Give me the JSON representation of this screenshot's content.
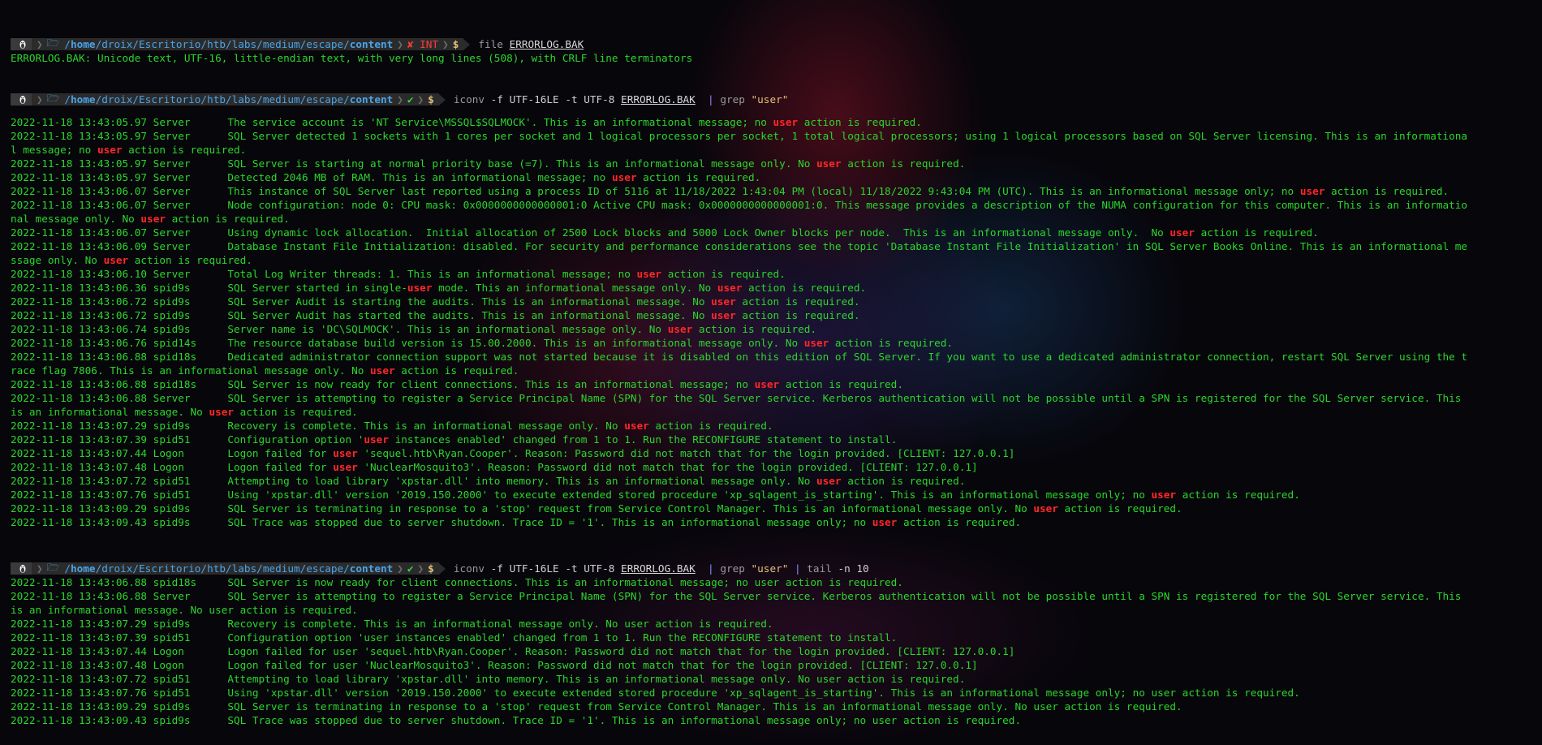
{
  "prompts": [
    {
      "os_icon": "linux-tux-icon",
      "folder_icon": "folder-open-icon",
      "path_prefix": "/",
      "path_home": "home",
      "path_middle": "/droix/Escritorio/htb/labs/medium/escape/",
      "path_last": "content",
      "status": "✘ INT",
      "status_color": "#ff3b3b",
      "dollar": "$",
      "cmd": [
        {
          "t": "file",
          "k": "c-dim"
        },
        {
          "t": " ",
          "k": ""
        },
        {
          "t": "ERRORLOG.BAK",
          "k": "c-file"
        }
      ]
    },
    {
      "os_icon": "linux-tux-icon",
      "folder_icon": "folder-open-icon",
      "path_prefix": "/",
      "path_home": "home",
      "path_middle": "/droix/Escritorio/htb/labs/medium/escape/",
      "path_last": "content",
      "status": "✔",
      "status_color": "#3cd63c",
      "dollar": "$",
      "cmd": [
        {
          "t": "iconv",
          "k": "c-dim"
        },
        {
          "t": " -f ",
          "k": "c-flag"
        },
        {
          "t": "UTF-16LE",
          "k": "c-flag"
        },
        {
          "t": " -t ",
          "k": "c-flag"
        },
        {
          "t": "UTF-8",
          "k": "c-flag"
        },
        {
          "t": " ",
          "k": ""
        },
        {
          "t": "ERRORLOG.BAK",
          "k": "c-file"
        },
        {
          "t": "  | ",
          "k": "c-pipe"
        },
        {
          "t": "grep",
          "k": "c-dim"
        },
        {
          "t": " ",
          "k": ""
        },
        {
          "t": "\"user\"",
          "k": "c-str"
        }
      ]
    },
    {
      "os_icon": "linux-tux-icon",
      "folder_icon": "folder-open-icon",
      "path_prefix": "/",
      "path_home": "home",
      "path_middle": "/droix/Escritorio/htb/labs/medium/escape/",
      "path_last": "content",
      "status": "✔",
      "status_color": "#3cd63c",
      "dollar": "$",
      "cmd": [
        {
          "t": "iconv",
          "k": "c-dim"
        },
        {
          "t": " -f ",
          "k": "c-flag"
        },
        {
          "t": "UTF-16LE",
          "k": "c-flag"
        },
        {
          "t": " -t ",
          "k": "c-flag"
        },
        {
          "t": "UTF-8",
          "k": "c-flag"
        },
        {
          "t": " ",
          "k": ""
        },
        {
          "t": "ERRORLOG.BAK",
          "k": "c-file"
        },
        {
          "t": "  | ",
          "k": "c-pipe"
        },
        {
          "t": "grep",
          "k": "c-dim"
        },
        {
          "t": " ",
          "k": ""
        },
        {
          "t": "\"user\"",
          "k": "c-str"
        },
        {
          "t": " | ",
          "k": "c-pipe"
        },
        {
          "t": "tail",
          "k": "c-dim"
        },
        {
          "t": " -n ",
          "k": "c-flag"
        },
        {
          "t": "10",
          "k": "c-flag"
        }
      ]
    }
  ],
  "outputs": [
    {
      "highlight": "",
      "lines": [
        "ERRORLOG.BAK: Unicode text, UTF-16, little-endian text, with very long lines (508), with CRLF line terminators"
      ]
    },
    {
      "highlight": "user",
      "lines": [
        "2022-11-18 13:43:05.97 Server      The service account is 'NT Service\\MSSQL$SQLMOCK'. This is an informational message; no user action is required.",
        "2022-11-18 13:43:05.97 Server      SQL Server detected 1 sockets with 1 cores per socket and 1 logical processors per socket, 1 total logical processors; using 1 logical processors based on SQL Server licensing. This is an informationa",
        "l message; no user action is required.",
        "2022-11-18 13:43:05.97 Server      SQL Server is starting at normal priority base (=7). This is an informational message only. No user action is required.",
        "2022-11-18 13:43:05.97 Server      Detected 2046 MB of RAM. This is an informational message; no user action is required.",
        "2022-11-18 13:43:06.07 Server      This instance of SQL Server last reported using a process ID of 5116 at 11/18/2022 1:43:04 PM (local) 11/18/2022 9:43:04 PM (UTC). This is an informational message only; no user action is required.",
        "2022-11-18 13:43:06.07 Server      Node configuration: node 0: CPU mask: 0x0000000000000001:0 Active CPU mask: 0x0000000000000001:0. This message provides a description of the NUMA configuration for this computer. This is an informatio",
        "nal message only. No user action is required.",
        "2022-11-18 13:43:06.07 Server      Using dynamic lock allocation.  Initial allocation of 2500 Lock blocks and 5000 Lock Owner blocks per node.  This is an informational message only.  No user action is required.",
        "2022-11-18 13:43:06.09 Server      Database Instant File Initialization: disabled. For security and performance considerations see the topic 'Database Instant File Initialization' in SQL Server Books Online. This is an informational me",
        "ssage only. No user action is required.",
        "2022-11-18 13:43:06.10 Server      Total Log Writer threads: 1. This is an informational message; no user action is required.",
        "2022-11-18 13:43:06.36 spid9s      SQL Server started in single-user mode. This an informational message only. No user action is required.",
        "2022-11-18 13:43:06.72 spid9s      SQL Server Audit is starting the audits. This is an informational message. No user action is required.",
        "2022-11-18 13:43:06.72 spid9s      SQL Server Audit has started the audits. This is an informational message. No user action is required.",
        "2022-11-18 13:43:06.74 spid9s      Server name is 'DC\\SQLMOCK'. This is an informational message only. No user action is required.",
        "2022-11-18 13:43:06.76 spid14s     The resource database build version is 15.00.2000. This is an informational message only. No user action is required.",
        "2022-11-18 13:43:06.88 spid18s     Dedicated administrator connection support was not started because it is disabled on this edition of SQL Server. If you want to use a dedicated administrator connection, restart SQL Server using the t",
        "race flag 7806. This is an informational message only. No user action is required.",
        "2022-11-18 13:43:06.88 spid18s     SQL Server is now ready for client connections. This is an informational message; no user action is required.",
        "2022-11-18 13:43:06.88 Server      SQL Server is attempting to register a Service Principal Name (SPN) for the SQL Server service. Kerberos authentication will not be possible until a SPN is registered for the SQL Server service. This",
        "is an informational message. No user action is required.",
        "2022-11-18 13:43:07.29 spid9s      Recovery is complete. This is an informational message only. No user action is required.",
        "2022-11-18 13:43:07.39 spid51      Configuration option 'user instances enabled' changed from 1 to 1. Run the RECONFIGURE statement to install.",
        "2022-11-18 13:43:07.44 Logon       Logon failed for user 'sequel.htb\\Ryan.Cooper'. Reason: Password did not match that for the login provided. [CLIENT: 127.0.0.1]",
        "2022-11-18 13:43:07.48 Logon       Logon failed for user 'NuclearMosquito3'. Reason: Password did not match that for the login provided. [CLIENT: 127.0.0.1]",
        "2022-11-18 13:43:07.72 spid51      Attempting to load library 'xpstar.dll' into memory. This is an informational message only. No user action is required.",
        "2022-11-18 13:43:07.76 spid51      Using 'xpstar.dll' version '2019.150.2000' to execute extended stored procedure 'xp_sqlagent_is_starting'. This is an informational message only; no user action is required.",
        "2022-11-18 13:43:09.29 spid9s      SQL Server is terminating in response to a 'stop' request from Service Control Manager. This is an informational message only. No user action is required.",
        "2022-11-18 13:43:09.43 spid9s      SQL Trace was stopped due to server shutdown. Trace ID = '1'. This is an informational message only; no user action is required."
      ]
    },
    {
      "highlight": "",
      "lines": [
        "2022-11-18 13:43:06.88 spid18s     SQL Server is now ready for client connections. This is an informational message; no user action is required.",
        "2022-11-18 13:43:06.88 Server      SQL Server is attempting to register a Service Principal Name (SPN) for the SQL Server service. Kerberos authentication will not be possible until a SPN is registered for the SQL Server service. This",
        "is an informational message. No user action is required.",
        "2022-11-18 13:43:07.29 spid9s      Recovery is complete. This is an informational message only. No user action is required.",
        "2022-11-18 13:43:07.39 spid51      Configuration option 'user instances enabled' changed from 1 to 1. Run the RECONFIGURE statement to install.",
        "2022-11-18 13:43:07.44 Logon       Logon failed for user 'sequel.htb\\Ryan.Cooper'. Reason: Password did not match that for the login provided. [CLIENT: 127.0.0.1]",
        "2022-11-18 13:43:07.48 Logon       Logon failed for user 'NuclearMosquito3'. Reason: Password did not match that for the login provided. [CLIENT: 127.0.0.1]",
        "2022-11-18 13:43:07.72 spid51      Attempting to load library 'xpstar.dll' into memory. This is an informational message only. No user action is required.",
        "2022-11-18 13:43:07.76 spid51      Using 'xpstar.dll' version '2019.150.2000' to execute extended stored procedure 'xp_sqlagent_is_starting'. This is an informational message only; no user action is required.",
        "2022-11-18 13:43:09.29 spid9s      SQL Server is terminating in response to a 'stop' request from Service Control Manager. This is an informational message only. No user action is required.",
        "2022-11-18 13:43:09.43 spid9s      SQL Trace was stopped due to server shutdown. Trace ID = '1'. This is an informational message only; no user action is required."
      ]
    }
  ]
}
